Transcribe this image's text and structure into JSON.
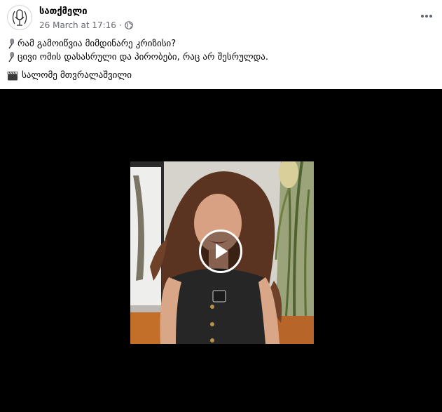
{
  "post": {
    "author": "სათქმელი",
    "timestamp": "26 March at 17:16",
    "separator": "·",
    "audience_icon": "globe-icon",
    "more_icon": "more-horizontal-icon",
    "lines": [
      {
        "icon": "microphone-emoji",
        "text": "რამ გამოიწვია მიმდინარე კრიზისი?"
      },
      {
        "icon": "microphone-emoji",
        "text": "ცივი ომის დასასრული და პირობები, რაც არ შესრულდა."
      },
      {
        "icon": "clapper-board-emoji",
        "text": "სალომე მთვრალაშვილი"
      }
    ]
  },
  "video": {
    "play_icon": "play-icon"
  }
}
